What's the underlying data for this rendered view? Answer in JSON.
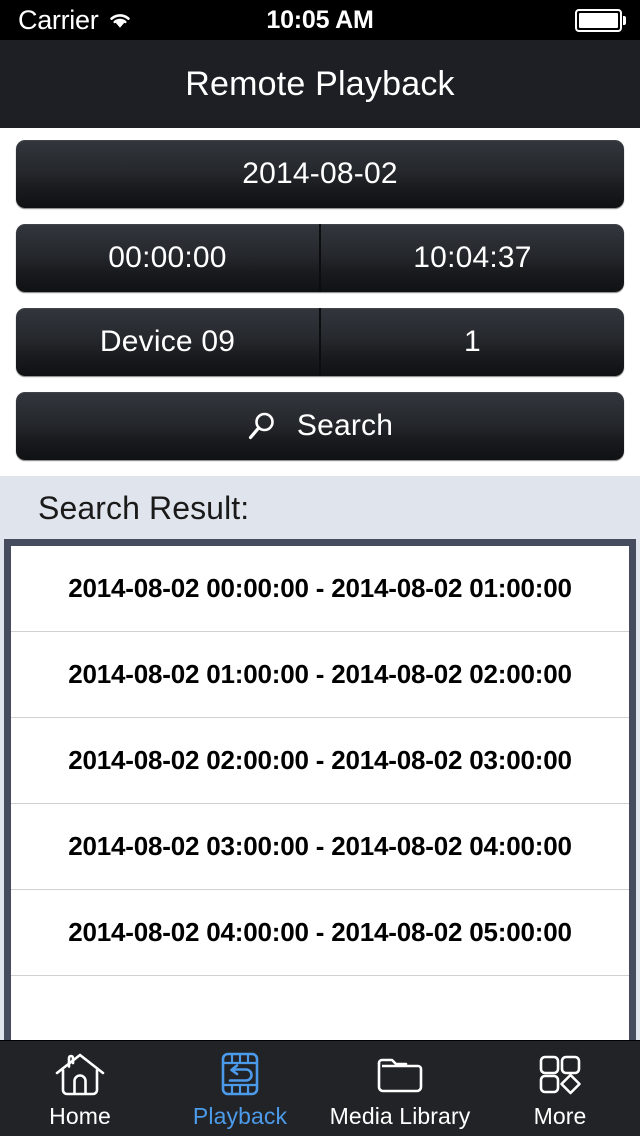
{
  "statusbar": {
    "carrier": "Carrier",
    "time": "10:05 AM",
    "wifi_icon": "wifi-icon",
    "battery_icon": "battery-full-icon"
  },
  "navbar": {
    "title": "Remote Playback"
  },
  "form": {
    "date_value": "2014-08-02",
    "start_time": "00:00:00",
    "end_time": "10:04:37",
    "device": "Device 09",
    "channel": "1",
    "search_label": "Search",
    "search_icon": "magnifier-icon"
  },
  "results": {
    "header": "Search Result:",
    "rows": [
      "2014-08-02 00:00:00 - 2014-08-02 01:00:00",
      "2014-08-02 01:00:00 - 2014-08-02 02:00:00",
      "2014-08-02 02:00:00 - 2014-08-02 03:00:00",
      "2014-08-02 03:00:00 - 2014-08-02 04:00:00",
      "2014-08-02 04:00:00 - 2014-08-02 05:00:00"
    ]
  },
  "tabbar": {
    "active_color": "#4c9bea",
    "inactive_color": "#ffffff",
    "items": [
      {
        "label": "Home",
        "icon": "house-icon"
      },
      {
        "label": "Playback",
        "icon": "film-replay-icon"
      },
      {
        "label": "Media Library",
        "icon": "folder-icon"
      },
      {
        "label": "More",
        "icon": "grid-diamond-icon"
      }
    ]
  }
}
